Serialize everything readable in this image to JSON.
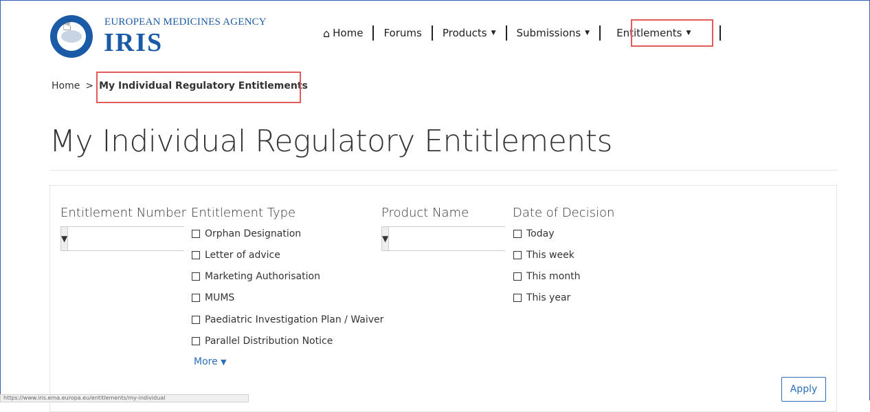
{
  "header": {
    "agency_name": "EUROPEAN MEDICINES AGENCY",
    "app_name": "IRIS",
    "nav": [
      {
        "label": "Home",
        "icon": "home-icon"
      },
      {
        "label": "Forums"
      },
      {
        "label": "Products",
        "dropdown": true
      },
      {
        "label": "Submissions",
        "dropdown": true
      },
      {
        "label": "Entitlements",
        "dropdown": true
      }
    ]
  },
  "breadcrumb": {
    "home": "Home",
    "separator": ">",
    "current": "My Individual Regulatory Entitlements"
  },
  "page_title": "My Individual Regulatory Entitlements",
  "filters": {
    "entitlement_number": {
      "label": "Entitlement Number",
      "value": ""
    },
    "entitlement_type": {
      "label": "Entitlement Type",
      "options": [
        "Orphan Designation",
        "Letter of advice",
        "Marketing Authorisation",
        "MUMS",
        "Paediatric Investigation Plan / Waiver",
        "Parallel Distribution Notice"
      ],
      "more": "More"
    },
    "product_name": {
      "label": "Product Name",
      "value": ""
    },
    "date_of_decision": {
      "label": "Date of Decision",
      "options": [
        "Today",
        "This week",
        "This month",
        "This year"
      ]
    },
    "apply_label": "Apply"
  },
  "status_bar": {
    "url": "https://www.iris.ema.europa.eu/entitlements/my-individual"
  },
  "colors": {
    "brand": "#1b5aa6",
    "highlight": "#e35a5a",
    "link": "#2a6ebb"
  }
}
